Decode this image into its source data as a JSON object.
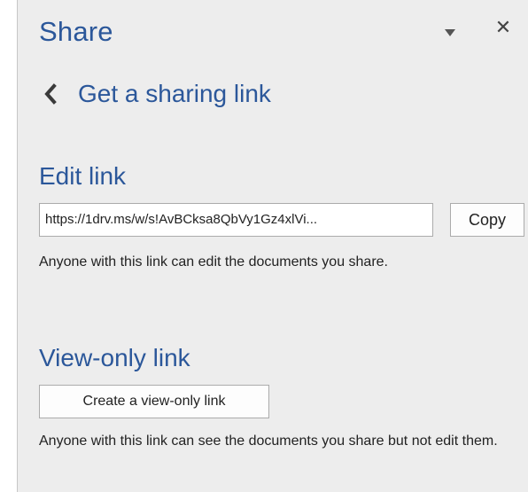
{
  "pane": {
    "title": "Share",
    "close_glyph": "✕",
    "dropdown_icon": "caret-down-icon",
    "close_icon": "close-icon"
  },
  "back": {
    "icon": "chevron-left-icon",
    "label": "Get a sharing link"
  },
  "edit_link": {
    "title": "Edit link",
    "url": "https://1drv.ms/w/s!AvBCksa8QbVy1Gz4xlVi...",
    "copy_label": "Copy",
    "description": "Anyone with this link can edit the documents you share."
  },
  "view_link": {
    "title": "View-only link",
    "create_label": "Create a view-only link",
    "description": "Anyone with this link can see the documents you share but not edit them."
  },
  "colors": {
    "accent": "#2b579a",
    "panel_bg": "#ededed",
    "border": "#ababab"
  }
}
